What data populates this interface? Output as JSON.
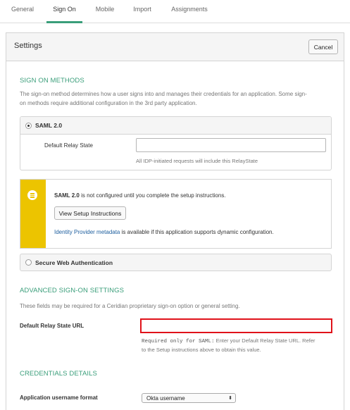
{
  "tabs": [
    {
      "label": "General"
    },
    {
      "label": "Sign On"
    },
    {
      "label": "Mobile"
    },
    {
      "label": "Import"
    },
    {
      "label": "Assignments"
    }
  ],
  "active_tab": "Sign On",
  "settings": {
    "title": "Settings",
    "cancel_label": "Cancel"
  },
  "sign_on_methods": {
    "heading": "SIGN ON METHODS",
    "description_line1": "The sign-on method determines how a user signs into and manages their credentials for an application. Some sign-",
    "description_line2": "on methods require additional configuration in the 3rd party application.",
    "saml": {
      "label": "SAML 2.0",
      "selected": true,
      "relay_state_label": "Default Relay State",
      "relay_state_value": "",
      "relay_state_help": "All IDP-initiated requests will include this RelayState"
    },
    "notice": {
      "bold_text": "SAML 2.0",
      "text": " is not configured until you complete the setup instructions.",
      "button_label": "View Setup Instructions",
      "link_text": "Identity Provider metadata",
      "link_suffix": " is available if this application supports dynamic configuration."
    },
    "swa": {
      "label": "Secure Web Authentication",
      "selected": false
    }
  },
  "advanced": {
    "heading": "ADVANCED SIGN-ON SETTINGS",
    "description": "These fields may be required for a Ceridian proprietary sign-on option or general setting.",
    "relay_url_label": "Default Relay State URL",
    "relay_url_value": "",
    "help_code": "Required only for SAML:",
    "help_line1": " Enter your Default Relay State URL. Refer",
    "help_line2": "to the Setup instructions above to obtain this value."
  },
  "credentials": {
    "heading": "CREDENTIALS DETAILS",
    "username_format_label": "Application username format",
    "username_format_value": "Okta username"
  },
  "colors": {
    "accent": "#3a9e7a",
    "notice_bar": "#ecc400",
    "highlight_border": "#e0121a",
    "link": "#1d5e9e"
  }
}
